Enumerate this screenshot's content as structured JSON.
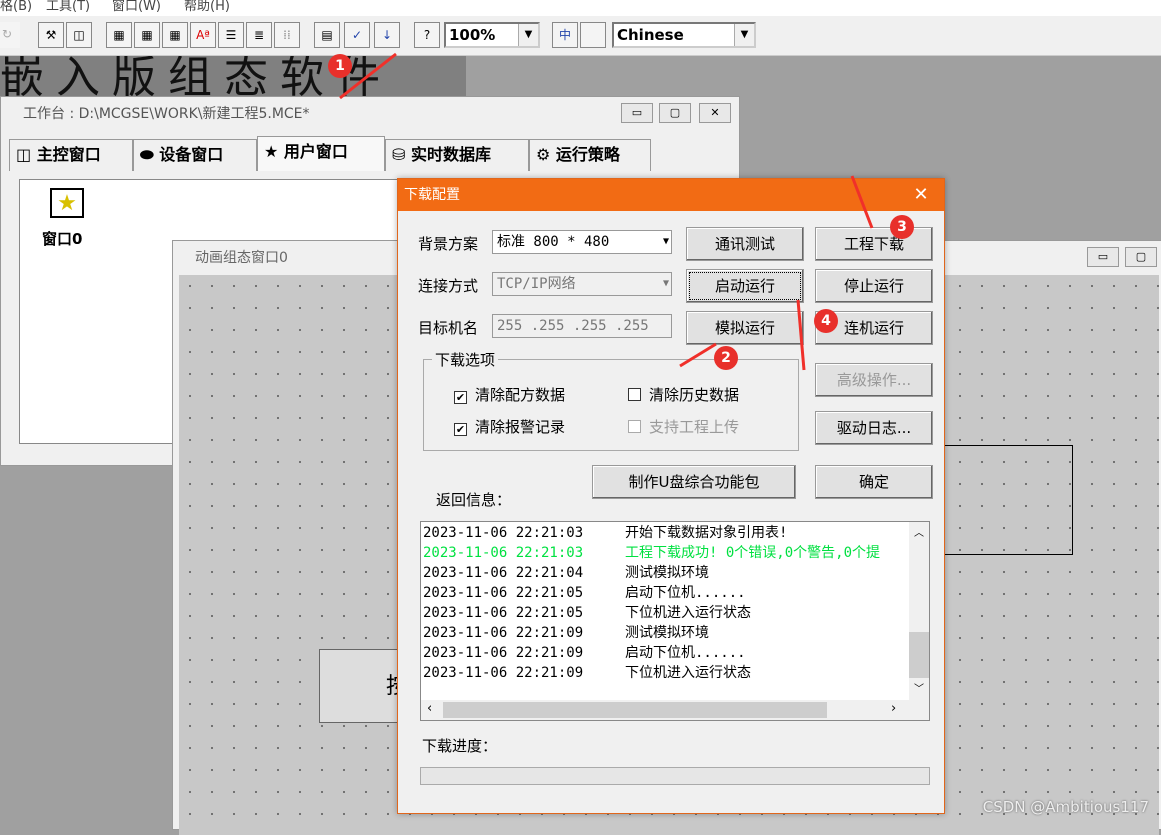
{
  "menubar": [
    "格(B)",
    "工具(T)",
    "窗口(W)",
    "帮助(H)"
  ],
  "toolbar": {
    "zoom": "100%",
    "language": "Chinese"
  },
  "background_text": "嵌入版组态软件",
  "workbench": {
    "title": "工作台 : D:\\MCGSE\\WORK\\新建工程5.MCE*",
    "tabs": [
      "主控窗口",
      "设备窗口",
      "用户窗口",
      "实时数据库",
      "运行策略"
    ],
    "window_item": "窗口0"
  },
  "anim_window": {
    "title": "动画组态窗口0",
    "button_partial": "按"
  },
  "dialog": {
    "title": "下载配置",
    "bg_label": "背景方案",
    "bg_value": "标准 800 * 480",
    "conn_label": "连接方式",
    "conn_value": "TCP/IP网络",
    "target_label": "目标机名",
    "target_value": "255 .255 .255 .255",
    "buttons": {
      "comm_test": "通讯测试",
      "start_run": "启动运行",
      "sim_run": "模拟运行",
      "project_download": "工程下载",
      "stop_run": "停止运行",
      "online_run": "连机运行",
      "advanced": "高级操作...",
      "driver_log": "驱动日志...",
      "usb_pack": "制作U盘综合功能包",
      "ok": "确定"
    },
    "options_label": "下载选项",
    "options": [
      {
        "label": "清除配方数据",
        "checked": true,
        "enabled": true
      },
      {
        "label": "清除历史数据",
        "checked": false,
        "enabled": true
      },
      {
        "label": "清除报警记录",
        "checked": true,
        "enabled": true
      },
      {
        "label": "支持工程上传",
        "checked": false,
        "enabled": false
      }
    ],
    "return_label": "返回信息：",
    "log": [
      {
        "time": "2023-11-06 22:21:03",
        "msg": "开始下载数据对象引用表!",
        "color": "#000000"
      },
      {
        "time": "2023-11-06 22:21:03",
        "msg": "工程下载成功! 0个错误,0个警告,0个提",
        "color": "#00e040"
      },
      {
        "time": "2023-11-06 22:21:04",
        "msg": "测试模拟环境",
        "color": "#000000"
      },
      {
        "time": "2023-11-06 22:21:05",
        "msg": "启动下位机......",
        "color": "#000000"
      },
      {
        "time": "2023-11-06 22:21:05",
        "msg": "下位机进入运行状态",
        "color": "#000000"
      },
      {
        "time": "2023-11-06 22:21:09",
        "msg": "测试模拟环境",
        "color": "#000000"
      },
      {
        "time": "2023-11-06 22:21:09",
        "msg": "启动下位机......",
        "color": "#000000"
      },
      {
        "time": "2023-11-06 22:21:09",
        "msg": "下位机进入运行状态",
        "color": "#000000"
      }
    ],
    "progress_label": "下载进度：",
    "progress": 0
  },
  "annotations": [
    "1",
    "2",
    "3",
    "4"
  ],
  "watermark": "CSDN @Ambitious117",
  "colors": {
    "accent": "#f26b14",
    "success": "#00e040",
    "badge": "#e8302b"
  }
}
